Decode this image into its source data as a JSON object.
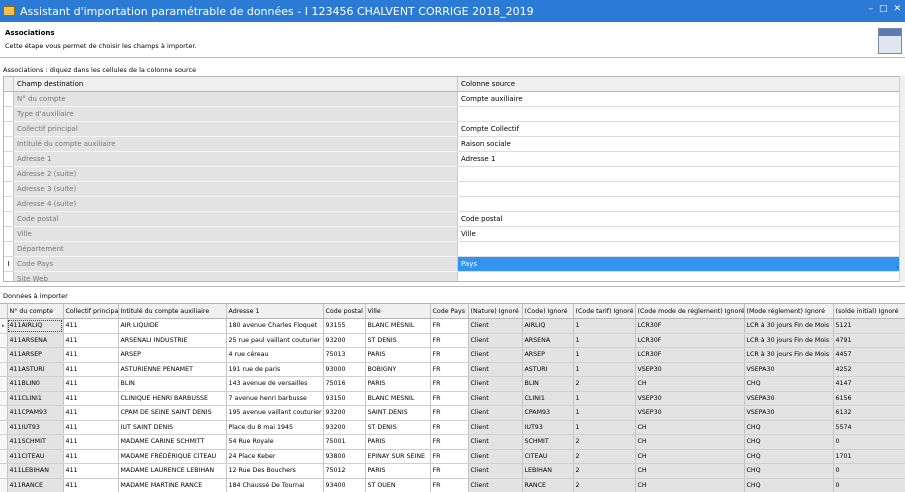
{
  "window": {
    "title": "Assistant d'importation paramétrable de données - I 123456 CHALVENT CORRIGE 2018_2019",
    "accent": "#2b7bd6"
  },
  "step": {
    "title": "Associations",
    "description": "Cette étape vous permet de choisir les champs à importer."
  },
  "associations": {
    "label": "Associations : diquez dans les cellules de la colonne source",
    "header_dest": "Champ destination",
    "header_src": "Colonne source",
    "rows": [
      {
        "dest": "N° du compte",
        "src": "Compte auxiliaire"
      },
      {
        "dest": "Type d'auxiliaire",
        "src": ""
      },
      {
        "dest": "Collectif principal",
        "src": "Compte Collectif"
      },
      {
        "dest": "Intitulé du compte auxiliaire",
        "src": "Raison sociale"
      },
      {
        "dest": "Adresse 1",
        "src": "Adresse 1"
      },
      {
        "dest": "Adresse 2 (suite)",
        "src": ""
      },
      {
        "dest": "Adresse 3 (suite)",
        "src": ""
      },
      {
        "dest": "Adresse 4 (suite)",
        "src": ""
      },
      {
        "dest": "Code postal",
        "src": "Code postal"
      },
      {
        "dest": "Ville",
        "src": "Ville"
      },
      {
        "dest": "Département",
        "src": ""
      },
      {
        "dest": "Code Pays",
        "src": "Pays"
      },
      {
        "dest": "Site Web",
        "src": ""
      }
    ],
    "active_row_marker": "I",
    "active_color": "#3294f0"
  },
  "data": {
    "label": "Données à importer",
    "row_marker": "▸",
    "columns": [
      "N° du compte",
      "Collectif principal",
      "Intitulé du compte auxiliaire",
      "Adresse 1",
      "Code postal",
      "Ville",
      "Code Pays",
      "(Nature) Ignoré",
      "(Code) Ignoré",
      "(Code tarif) Ignoré",
      "(Code mode de réglement) Ignoré",
      "(Mode réglement) Ignoré",
      "(solde initial) Ignoré"
    ],
    "rows": [
      [
        "411AIRLIQ",
        "411",
        "AIR LIQUIDE",
        "180 avenue Charles Floquet",
        "93155",
        "BLANC MESNIL",
        "FR",
        "Client",
        "AIRLIQ",
        "1",
        "LCR30F",
        "LCR à 30 jours Fin de Mois",
        "5121"
      ],
      [
        "411ARSENA",
        "411",
        "ARSENALI INDUSTRIE",
        "25 rue paul vaillant couturier",
        "93200",
        "ST DENIS",
        "FR",
        "Client",
        "ARSENA",
        "1",
        "LCR30F",
        "LCR à 30 jours Fin de Mois",
        "4791"
      ],
      [
        "411ARSEP",
        "411",
        "ARSEP",
        "4 rue céreau",
        "75013",
        "PARIS",
        "FR",
        "Client",
        "ARSEP",
        "1",
        "LCR30F",
        "LCR à 30 jours Fin de Mois",
        "4457"
      ],
      [
        "411ASTURI",
        "411",
        "ASTURIENNE PENAMET",
        "191 rue de paris",
        "93000",
        "BOBIGNY",
        "FR",
        "Client",
        "ASTURI",
        "1",
        "VSEP30",
        "VSEPA30",
        "4252"
      ],
      [
        "411BLIN0",
        "411",
        "BLIN",
        "143 avenue de versailles",
        "75016",
        "PARIS",
        "FR",
        "Client",
        "BLIN",
        "2",
        "CH",
        "CHQ",
        "4147"
      ],
      [
        "411CLINI1",
        "411",
        "CLINIQUE HENRI BARBUSSE",
        "7 avenue henri barbusse",
        "93150",
        "BLANC MESNIL",
        "FR",
        "Client",
        "CLINI1",
        "1",
        "VSEP30",
        "VSEPA30",
        "6156"
      ],
      [
        "411CPAM93",
        "411",
        "CPAM DE SEINE SAINT DENIS",
        "195 avenue vaillant couturier",
        "93200",
        "SAINT DENIS",
        "FR",
        "Client",
        "CPAM93",
        "1",
        "VSEP30",
        "VSEPA30",
        "6132"
      ],
      [
        "411IUT93",
        "411",
        "IUT SAINT DENIS",
        "Place du 8 mai 1945",
        "93200",
        "ST DENIS",
        "FR",
        "Client",
        "IUT93",
        "1",
        "CH",
        "CHQ",
        "5574"
      ],
      [
        "411SCHMIT",
        "411",
        "MADAME CARINE SCHMITT",
        "54 Rue Royale",
        "75001",
        "PARIS",
        "FR",
        "Client",
        "SCHMIT",
        "2",
        "CH",
        "CHQ",
        "0"
      ],
      [
        "411CITEAU",
        "411",
        "MADAME FRÉDÉRIQUE CITEAU",
        "24 Place Keber",
        "93800",
        "EPINAY SUR SEINE",
        "FR",
        "Client",
        "CITEAU",
        "2",
        "CH",
        "CHQ",
        "1701"
      ],
      [
        "411LEBIHAN",
        "411",
        "MADAME LAURENCE LEBIHAN",
        "12 Rue Des Bouchers",
        "75012",
        "PARIS",
        "FR",
        "Client",
        "LEBIHAN",
        "2",
        "CH",
        "CHQ",
        "0"
      ],
      [
        "411RANCE",
        "411",
        "MADAME MARTINE RANCE",
        "184 Chaussé De Tournai",
        "93400",
        "ST OUEN",
        "FR",
        "Client",
        "RANCE",
        "2",
        "CH",
        "CHQ",
        "0"
      ]
    ]
  }
}
